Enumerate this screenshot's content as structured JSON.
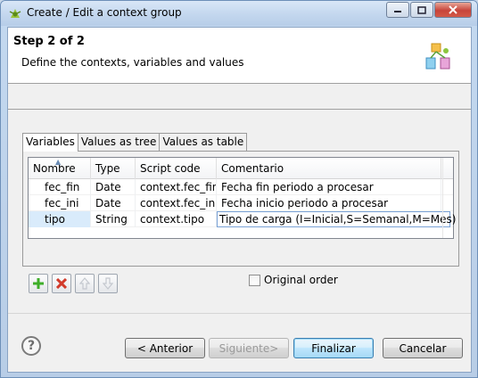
{
  "window": {
    "title": "Create / Edit a context group"
  },
  "header": {
    "step": "Step 2 of 2",
    "description": "Define the contexts, variables and values"
  },
  "tabs": [
    {
      "label": "Variables",
      "active": true
    },
    {
      "label": "Values as tree",
      "active": false
    },
    {
      "label": "Values as table",
      "active": false
    }
  ],
  "table": {
    "columns": [
      "Nombre",
      "Type",
      "Script code",
      "Comentario"
    ],
    "rows": [
      {
        "name": "fec_fin",
        "type": "Date",
        "script": "context.fec_fin",
        "comment": "Fecha fin periodo a procesar"
      },
      {
        "name": "fec_ini",
        "type": "Date",
        "script": "context.fec_ini",
        "comment": "Fecha inicio periodo a procesar"
      },
      {
        "name": "tipo",
        "type": "String",
        "script": "context.tipo",
        "comment": "Tipo de carga (I=Inicial,S=Semanal,M=Mes)"
      }
    ]
  },
  "toolbar": {
    "add_icon": "plus-icon",
    "remove_icon": "remove-icon",
    "up_icon": "arrow-up-icon",
    "down_icon": "arrow-down-icon"
  },
  "original_order": {
    "label": "Original order",
    "checked": false
  },
  "buttons": {
    "back": "< Anterior",
    "next": "Siguiente>",
    "finish": "Finalizar",
    "cancel": "Cancelar"
  },
  "colors": {
    "add": "#3fae2a",
    "remove": "#d23b2b",
    "selection": "#d9ebfb"
  }
}
